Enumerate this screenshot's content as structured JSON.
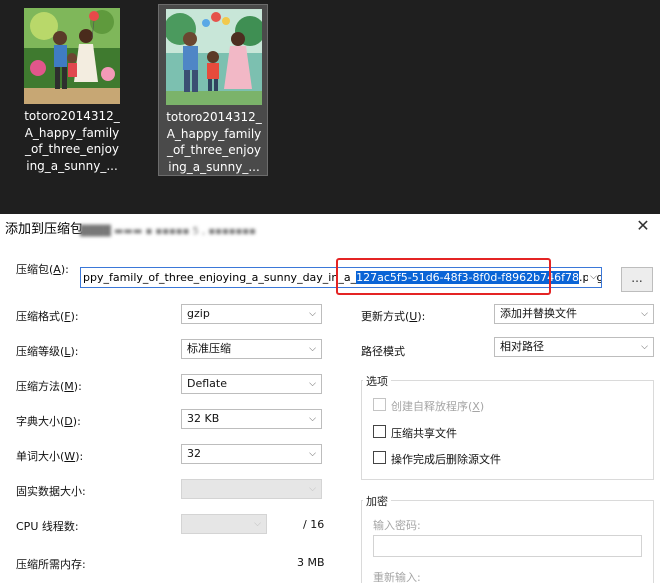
{
  "desktop": {
    "files": [
      {
        "name_lines": [
          "totoro2014312_",
          "A_happy_family",
          "_of_three_enjoy",
          "ing_a_sunny_..."
        ],
        "selected": false
      },
      {
        "name_lines": [
          "totoro2014312_",
          "A_happy_family",
          "_of_three_enjoy",
          "ing_a_sunny_..."
        ],
        "selected": true
      }
    ]
  },
  "dialog": {
    "title": "添加到压缩包",
    "close_glyph": "✕",
    "archive_label": "压缩包",
    "archive_key": "A",
    "archive_path_prefix": "ppy_family_of_three_enjoying_a_sunny_day_in_a_",
    "archive_path_selected": "127ac5f5-51d6-48f3-8f0d-f8962b746f78",
    "archive_path_suffix": ".png.gz",
    "browse_label": "...",
    "left_fields": [
      {
        "label": "压缩格式",
        "key": "F",
        "value": "gzip",
        "disabled": false
      },
      {
        "label": "压缩等级",
        "key": "L",
        "value": "标准压缩",
        "disabled": false
      },
      {
        "label": "压缩方法",
        "key": "M",
        "value": "Deflate",
        "disabled": false
      },
      {
        "label": "字典大小",
        "key": "D",
        "value": "32 KB",
        "disabled": false
      },
      {
        "label": "单词大小",
        "key": "W",
        "value": "32",
        "disabled": false
      },
      {
        "label": "固实数据大小",
        "key": "",
        "value": "",
        "disabled": true
      }
    ],
    "cpu_threads": {
      "label": "CPU 线程数",
      "value": "",
      "max": "/ 16"
    },
    "memory": {
      "label": "压缩所需内存",
      "value": "3 MB"
    },
    "update_mode": {
      "label": "更新方式",
      "key": "U",
      "value": "添加并替换文件"
    },
    "path_mode": {
      "label": "路径模式",
      "value": "相对路径"
    },
    "options": {
      "title": "选项",
      "items": [
        {
          "label": "创建自释放程序",
          "key": "X",
          "disabled": true,
          "checked": false
        },
        {
          "label": "压缩共享文件",
          "key": "",
          "disabled": false,
          "checked": false
        },
        {
          "label": "操作完成后删除源文件",
          "key": "",
          "disabled": false,
          "checked": false
        }
      ]
    },
    "encryption": {
      "title": "加密",
      "password_label": "输入密码",
      "reenter_label": "重新输入"
    },
    "chevron": "⌵"
  }
}
